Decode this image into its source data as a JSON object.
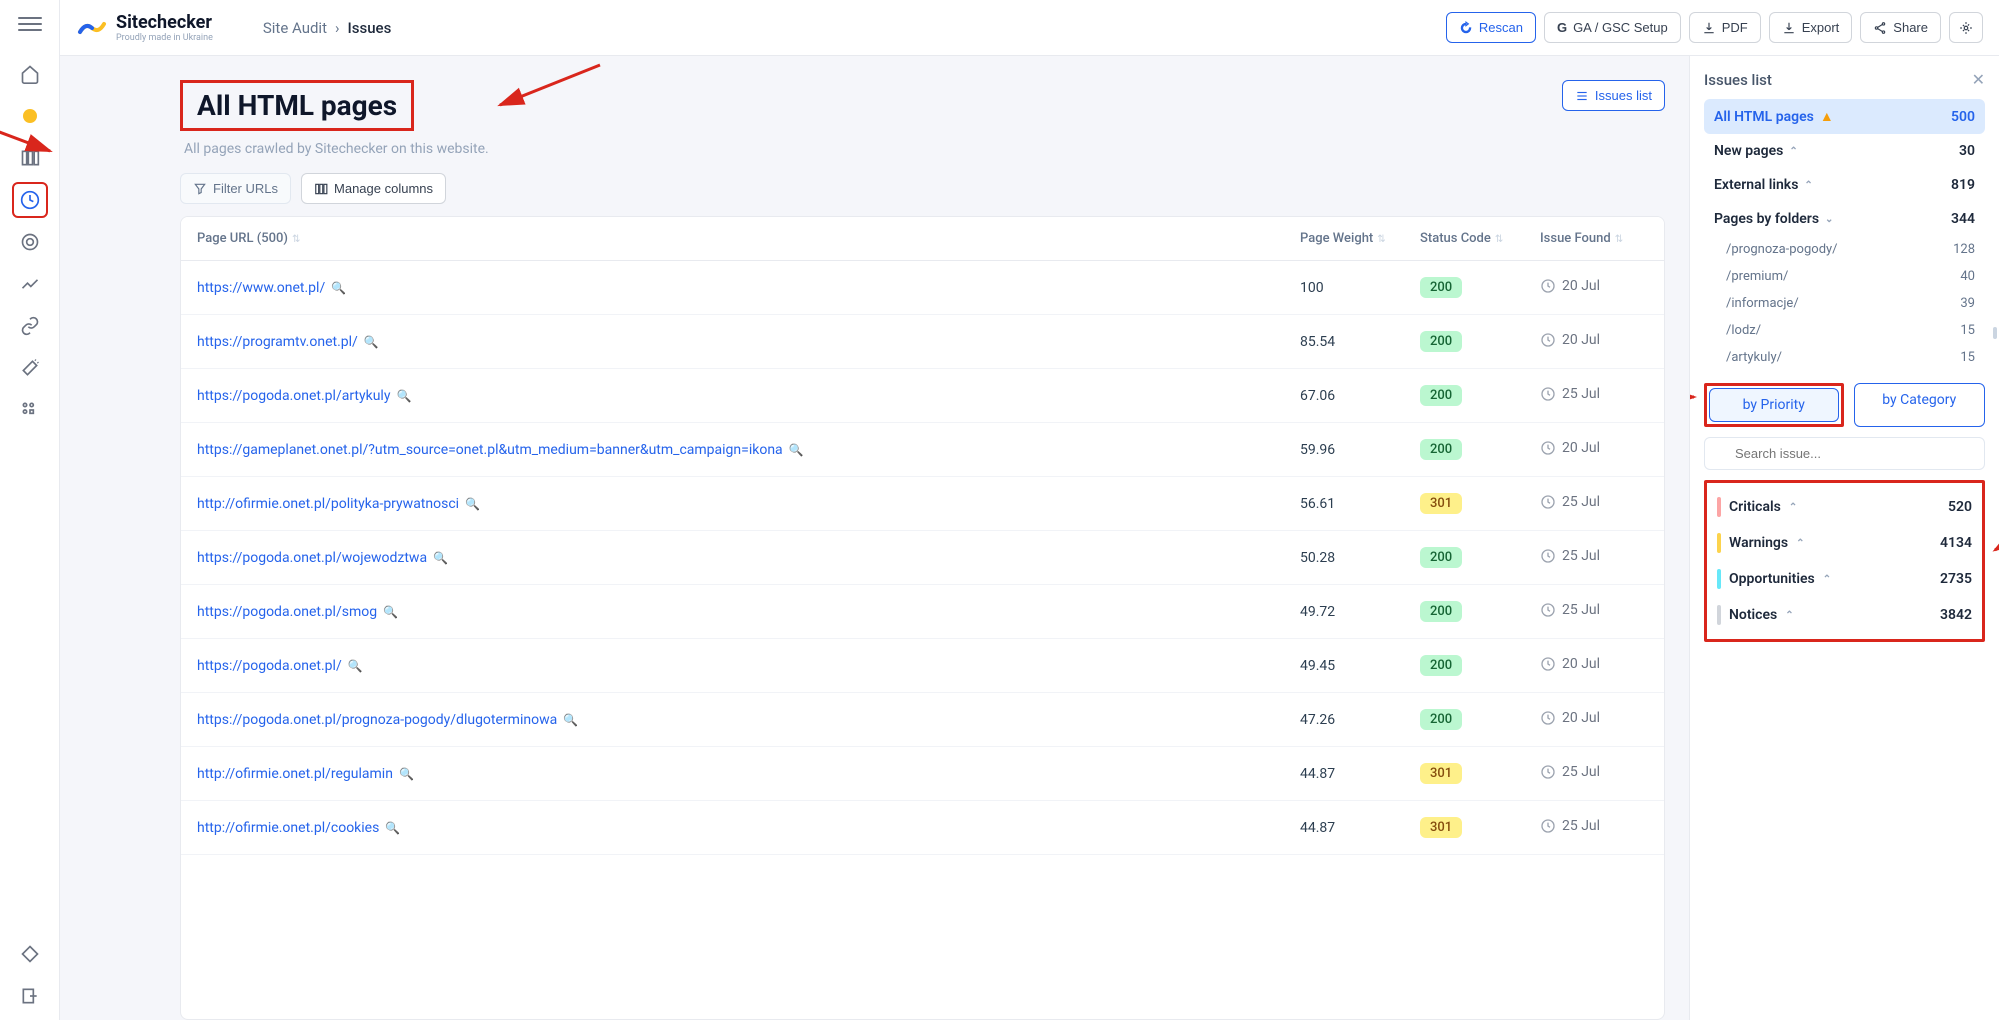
{
  "logo": {
    "title": "Sitechecker",
    "subtitle": "Proudly made in Ukraine"
  },
  "breadcrumb": {
    "parent": "Site Audit",
    "sep": "›",
    "current": "Issues"
  },
  "topActions": {
    "rescan": "Rescan",
    "gaGsc": "GA / GSC Setup",
    "pdf": "PDF",
    "export": "Export",
    "share": "Share"
  },
  "page": {
    "title": "All HTML pages",
    "subtitle": "All pages crawled by Sitechecker on this website.",
    "issuesListBtn": "Issues list"
  },
  "filters": {
    "filterUrls": "Filter URLs",
    "manageCols": "Manage columns"
  },
  "table": {
    "colUrl": "Page URL (500)",
    "colWeight": "Page Weight",
    "colStatus": "Status Code",
    "colIssue": "Issue Found",
    "rows": [
      {
        "url": "https://www.onet.pl/",
        "weight": "100",
        "status": "200",
        "date": "20 Jul"
      },
      {
        "url": "https://programtv.onet.pl/",
        "weight": "85.54",
        "status": "200",
        "date": "20 Jul"
      },
      {
        "url": "https://pogoda.onet.pl/artykuly",
        "weight": "67.06",
        "status": "200",
        "date": "25 Jul"
      },
      {
        "url": "https://gameplanet.onet.pl/?utm_source=onet.pl&utm_medium=banner&utm_campaign=ikona",
        "weight": "59.96",
        "status": "200",
        "date": "20 Jul"
      },
      {
        "url": "http://ofirmie.onet.pl/polityka-prywatnosci",
        "weight": "56.61",
        "status": "301",
        "date": "25 Jul"
      },
      {
        "url": "https://pogoda.onet.pl/wojewodztwa",
        "weight": "50.28",
        "status": "200",
        "date": "25 Jul"
      },
      {
        "url": "https://pogoda.onet.pl/smog",
        "weight": "49.72",
        "status": "200",
        "date": "25 Jul"
      },
      {
        "url": "https://pogoda.onet.pl/",
        "weight": "49.45",
        "status": "200",
        "date": "20 Jul"
      },
      {
        "url": "https://pogoda.onet.pl/prognoza-pogody/dlugoterminowa",
        "weight": "47.26",
        "status": "200",
        "date": "20 Jul"
      },
      {
        "url": "http://ofirmie.onet.pl/regulamin",
        "weight": "44.87",
        "status": "301",
        "date": "25 Jul"
      },
      {
        "url": "http://ofirmie.onet.pl/cookies",
        "weight": "44.87",
        "status": "301",
        "date": "25 Jul"
      }
    ]
  },
  "issuesPanel": {
    "header": "Issues list",
    "allHtml": {
      "label": "All HTML pages",
      "count": "500"
    },
    "newPages": {
      "label": "New pages",
      "count": "30"
    },
    "external": {
      "label": "External links",
      "count": "819"
    },
    "byFolders": {
      "label": "Pages by folders",
      "count": "344"
    },
    "folders": [
      {
        "path": "/prognoza-pogody/",
        "count": "128"
      },
      {
        "path": "/premium/",
        "count": "40"
      },
      {
        "path": "/informacje/",
        "count": "39"
      },
      {
        "path": "/lodz/",
        "count": "15"
      },
      {
        "path": "/artykuly/",
        "count": "15"
      }
    ],
    "toggle": {
      "priority": "by Priority",
      "category": "by Category"
    },
    "searchPlaceholder": "Search issue...",
    "priorities": [
      {
        "label": "Criticals",
        "count": "520",
        "cls": "crit"
      },
      {
        "label": "Warnings",
        "count": "4134",
        "cls": "warn"
      },
      {
        "label": "Opportunities",
        "count": "2735",
        "cls": "opp"
      },
      {
        "label": "Notices",
        "count": "3842",
        "cls": "not"
      }
    ]
  }
}
